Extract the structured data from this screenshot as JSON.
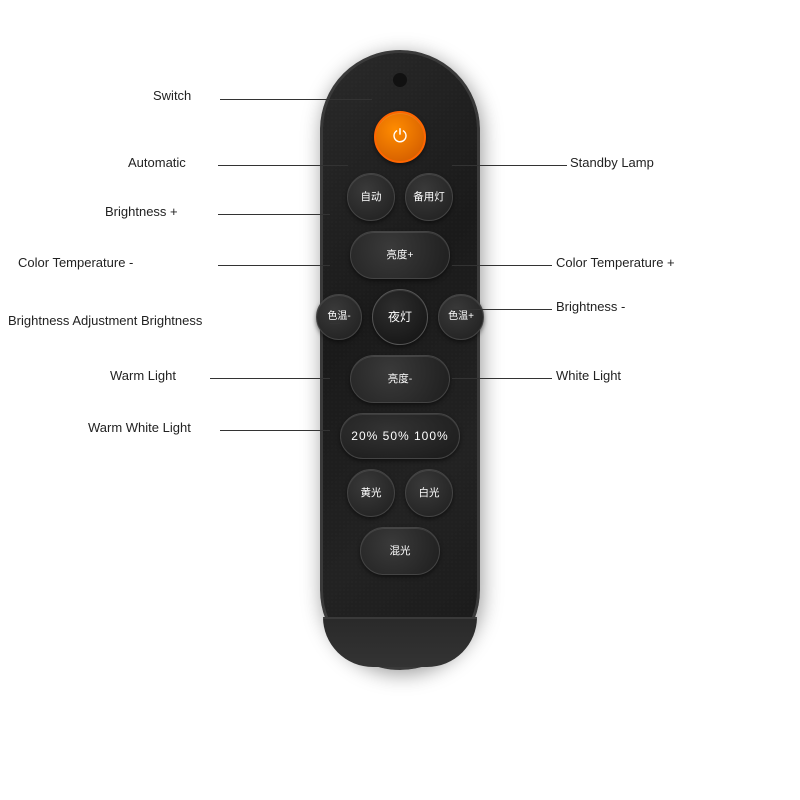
{
  "remote": {
    "power_icon": "⏻",
    "buttons": {
      "auto": "自动",
      "standby": "备用灯",
      "brightness_plus": "亮度+",
      "color_temp_minus": "色温-",
      "night_light": "夜灯",
      "color_temp_plus": "色温+",
      "brightness_minus": "亮度-",
      "brightness_levels": "20% 50% 100%",
      "warm_light": "黄光",
      "white_light": "白光",
      "warm_white": "混光"
    }
  },
  "labels": {
    "switch": "Switch",
    "automatic": "Automatic",
    "brightness_plus": "Brightness +",
    "color_temp_minus": "Color Temperature -",
    "brightness_adj": "Brightness Adjustment Brightness",
    "warm_light": "Warm Light",
    "warm_white_light": "Warm White Light",
    "standby_lamp": "Standby Lamp",
    "color_temp_plus": "Color Temperature +",
    "brightness_minus": "Brightness -",
    "white_light": "White Light"
  }
}
